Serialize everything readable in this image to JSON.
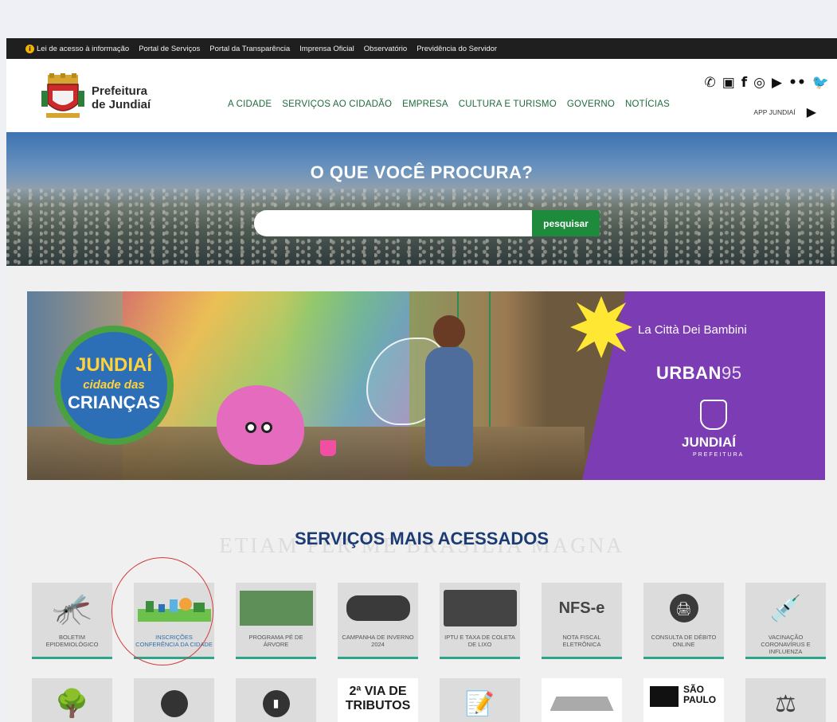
{
  "utility": {
    "items": [
      "Lei de acesso à informação",
      "Portal de Serviços",
      "Portal da Transparência",
      "Imprensa Oficial",
      "Observatório",
      "Previdência do Servidor"
    ]
  },
  "header": {
    "brand_line1": "Prefeitura",
    "brand_line2": "de Jundiaí",
    "nav": [
      "A CIDADE",
      "SERVIÇOS AO CIDADÃO",
      "EMPRESA",
      "CULTURA E TURISMO",
      "GOVERNO",
      "NOTÍCIAS"
    ],
    "social_icons": [
      "whatsapp-icon",
      "linkedin-icon",
      "facebook-icon",
      "instagram-icon",
      "youtube-icon",
      "flickr-icon",
      "twitter-icon"
    ],
    "app_label": "APP JUNDIAÍ"
  },
  "hero": {
    "title": "O QUE VOCÊ PROCURA?",
    "search_value": "",
    "search_button": "pesquisar"
  },
  "banner": {
    "globe_line1": "JUNDIAÍ",
    "globe_line2": "cidade das",
    "globe_line3": "CRIANÇAS",
    "bambini": "La Città Dei Bambini",
    "urban": "URBAN",
    "urban_num": "95",
    "jundiai": "JUNDIAÍ",
    "prefeitura": "PREFEITURA"
  },
  "watermark": {
    "line1": "ETIAM PER ME BRASILIA MAGNA"
  },
  "services": {
    "title": "SERVIÇOS MAIS ACESSADOS",
    "row1": [
      {
        "label": "BOLETIM EPIDEMIOLÓGICO",
        "icon": "mosquito-icon"
      },
      {
        "label": "INSCRIÇÕES CONFERÊNCIA DA CIDADE",
        "icon": "city-illustration-icon"
      },
      {
        "label": "PROGRAMA PÉ DE ÁRVORE",
        "icon": "pe-de-arvore-logo"
      },
      {
        "label": "CAMPANHA DE INVERNO 2024",
        "icon": "campanha-inverno-logo"
      },
      {
        "label": "IPTU E TAXA DE COLETA DE LIXO",
        "icon": "iptu-card-icon"
      },
      {
        "label": "NOTA FISCAL ELETRÔNICA",
        "icon": "nfse-icon"
      },
      {
        "label": "CONSULTA DE DÉBITO ONLINE",
        "icon": "printer-icon"
      },
      {
        "label": "VACINAÇÃO CORONAVÍRUS E INFLUENZA",
        "icon": "vaccination-icon"
      }
    ],
    "row2_text": {
      "tributos_line1": "2ª VIA DE",
      "tributos_line2": "TRIBUTOS",
      "sp_line1": "SÃO",
      "sp_line2": "PAULO"
    }
  }
}
